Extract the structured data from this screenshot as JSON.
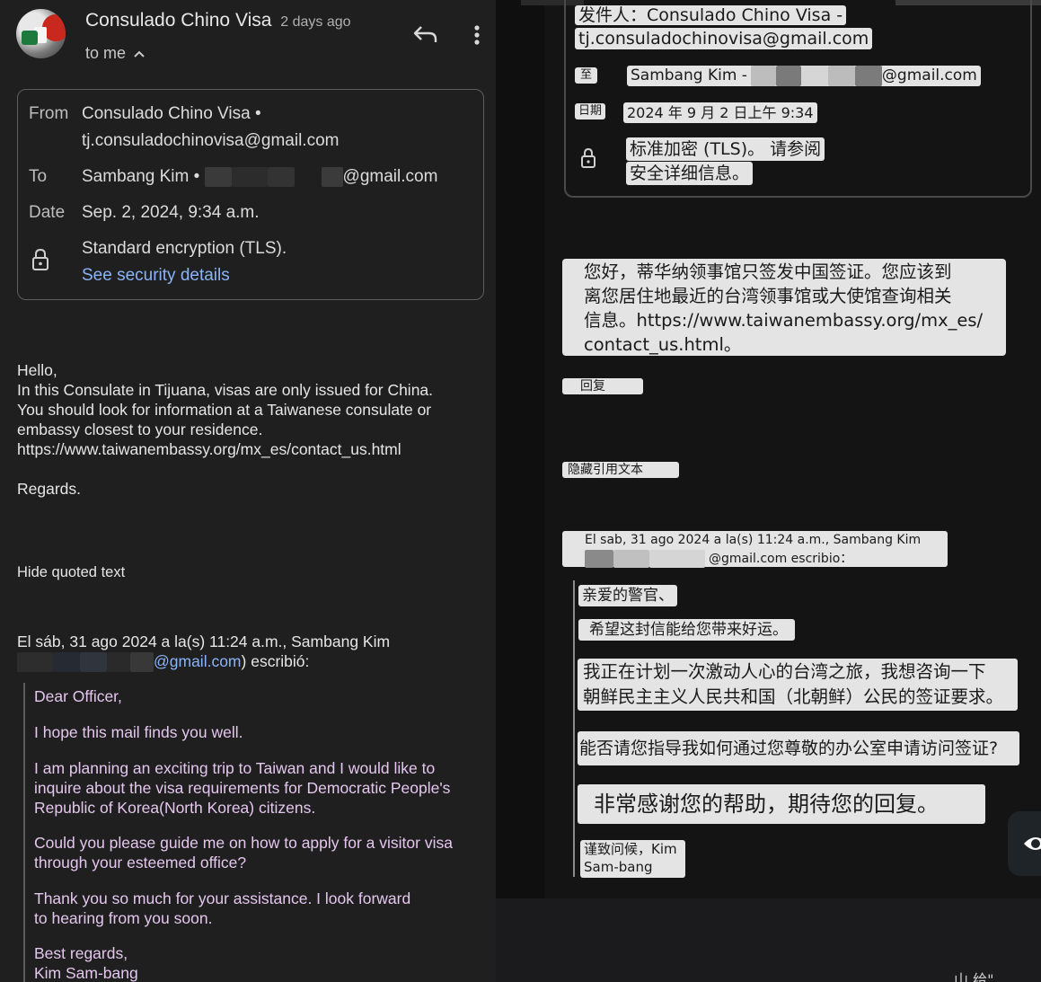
{
  "left": {
    "sender_name": "Consulado Chino Visa",
    "time_ago": "2 days ago",
    "to_me": "to me",
    "header": {
      "from_label": "From",
      "from_name": "Consulado Chino Visa •",
      "from_email": "tj.consuladochinovisa@gmail.com",
      "to_label": "To",
      "to_name": "Sambang Kim •",
      "to_email_tail": "@gmail.com",
      "date_label": "Date",
      "date_value": "Sep. 2, 2024, 9:34 a.m.",
      "encryption": "Standard encryption (TLS).",
      "security_link": "See security details"
    },
    "body": {
      "line1": "Hello,",
      "line2": "In this Consulate in Tijuana, visas are only issued for China.",
      "line3": "You should look for information at a Taiwanese consulate or",
      "line4": "embassy closest to your residence.",
      "link": "https://www.taiwanembassy.org/mx_es/contact_us.html",
      "regards": "Regards."
    },
    "hide_quoted": "Hide quoted text",
    "quote_header1": "El sáb, 31 ago 2024 a la(s) 11:24 a.m., Sambang Kim",
    "quote_header2_email": "@gmail.com",
    "quote_header2_tail": ") escribió:",
    "quoted": {
      "greeting": "Dear Officer,",
      "hope": "I hope this mail finds you well.",
      "plan1": "I am planning an exciting trip to Taiwan and I would like to",
      "plan2": "inquire about the visa requirements for Democratic People's",
      "plan3": "Republic of Korea(North Korea) citizens.",
      "guide1": "Could you please guide me on how to apply for a visitor visa",
      "guide2": "through your esteemed office?",
      "thanks1": "Thank you so much for your assistance. I look forward",
      "thanks2": "to hearing from you soon.",
      "best": "Best regards,",
      "name": "Kim Sam-bang"
    }
  },
  "right": {
    "sender_line1": "发件人：Consulado Chino Visa -",
    "sender_line2": "tj.consuladochinovisa@gmail.com",
    "to_label": "至",
    "to_name": "Sambang Kim -",
    "to_email_tail": "@gmail.com",
    "date_label": "日期",
    "date_value": "2024 年 9 月 2 日上午 9:34",
    "enc_line1": "标准加密 (TLS)。 请参阅",
    "enc_line2": "安全详细信息。",
    "body1": "您好，蒂华纳领事馆只签发中国签证。您应该到",
    "body2": "离您居住地最近的台湾领事馆或大使馆查询相关",
    "body3": "信息。https://www.taiwanembassy.org/mx_es/",
    "body4": "contact_us.html。",
    "reply": "回复",
    "hide_quoted": "隐藏引用文本",
    "quote_header1": "El sab, 31 ago 2024 a la(s) 11:24 a.m., Sambang Kim",
    "quote_header2_tail": "@gmail.com escribio：",
    "q_greeting": "亲爱的警官、",
    "q_hope": "希望这封信能给您带来好运。",
    "q_plan1": "我正在计划一次激动人心的台湾之旅，我想咨询一下",
    "q_plan2": "朝鲜民主主义人民共和国（北朝鲜）公民的签证要求。",
    "q_guide": "能否请您指导我如何通过您尊敬的办公室申请访问签证?",
    "q_thanks": "非常感谢您的帮助，期待您的回复。",
    "q_sign1": "谨致问候，Kim",
    "q_sign2": "Sam-bang",
    "bottom_text": "山   给\""
  }
}
